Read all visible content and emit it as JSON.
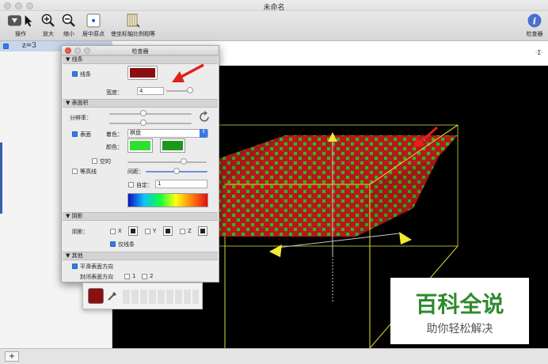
{
  "window": {
    "title": "未命名"
  },
  "toolbar": {
    "items": [
      {
        "label": "操作",
        "icon": "cursor-icon"
      },
      {
        "label": "放大",
        "icon": "zoom-in-icon"
      },
      {
        "label": "缩小",
        "icon": "zoom-out-icon"
      },
      {
        "label": "居中原点",
        "icon": "center-origin-icon"
      },
      {
        "label": "使坐标轴比例相等",
        "icon": "equal-axes-icon"
      },
      {
        "label": "检查器",
        "icon": "info-icon"
      }
    ]
  },
  "sidebar": {
    "equation": "z=3",
    "equation_checked": true
  },
  "plot": {
    "sigma_button": "·Σ·",
    "mesh_color": "#c81b1b",
    "grid_color": "#19d019",
    "box_color": "#e6e62e"
  },
  "inspector": {
    "title": "检查器",
    "lines": {
      "header": "线条",
      "checkbox_label": "线条",
      "checked": true,
      "color": "#8b0f0f",
      "width_label": "宽度：",
      "width_value": "4"
    },
    "surface": {
      "header": "表面积",
      "resolution_label": "分辨率：",
      "surface_label": "表面",
      "surface_checked": true,
      "coloring_label": "着色：",
      "coloring_value": "棋盘",
      "color_label": "颜色：",
      "color1": "#2ee02e",
      "color2": "#1a9a1a",
      "hollow_label": "空的",
      "hollow_checked": false,
      "contour_label": "等高线",
      "contour_checked": false,
      "spacing_label": "间距：",
      "custom_label": "自定：",
      "custom_checked": false,
      "custom_value": "1"
    },
    "shadow": {
      "header": "阴影",
      "label": "阴影：",
      "axes": [
        "X",
        "Y",
        "Z"
      ],
      "lines_only_label": "仅线条",
      "lines_only_checked": true
    },
    "other": {
      "header": "其他",
      "smooth_label": "平滑表面方向",
      "smooth_checked": true,
      "closed_label": "封闭表面方向",
      "closed_options": [
        "1",
        "2"
      ]
    }
  },
  "color_popover": {
    "swatch": "#8b0f0f"
  },
  "watermark": {
    "title": "百科全说",
    "subtitle": "助你轻松解决"
  },
  "bottombar": {
    "add_label": "+"
  }
}
